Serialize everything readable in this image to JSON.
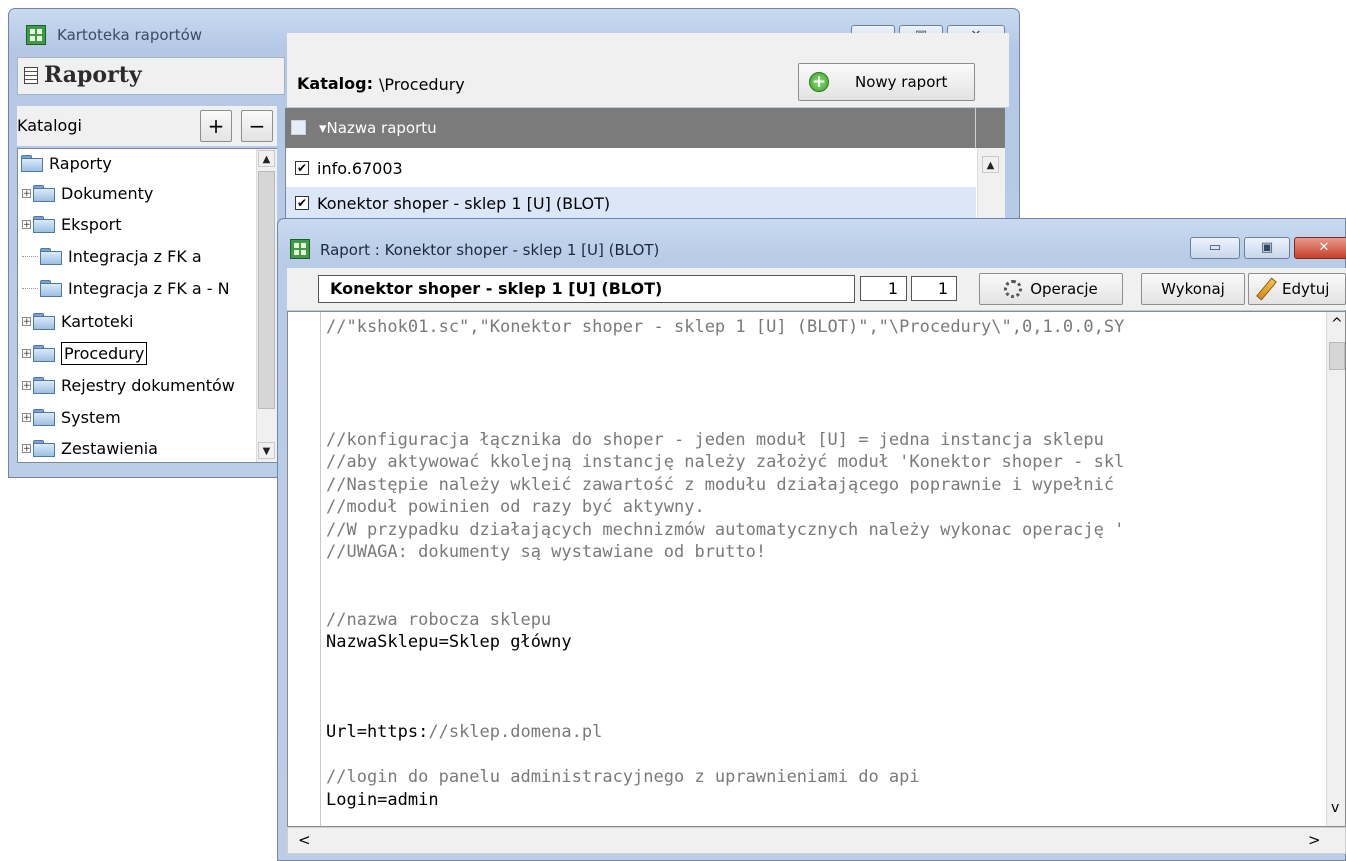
{
  "window_main": {
    "title": "Kartoteka raportów",
    "controls": {
      "minimize": "▭",
      "maximize": "▣",
      "close": "✕"
    }
  },
  "left_panel": {
    "header": "Raporty",
    "katalogi_label": "Katalogi",
    "add_label": "+",
    "remove_label": "−",
    "tree": [
      {
        "label": "Raporty",
        "expander": "",
        "selected": false
      },
      {
        "label": "Dokumenty",
        "expander": "+",
        "selected": false
      },
      {
        "label": "Eksport",
        "expander": "+",
        "selected": false
      },
      {
        "label": "Integracja z FK a",
        "expander": "",
        "selected": false
      },
      {
        "label": "Integracja z FK a - N",
        "expander": "",
        "selected": false
      },
      {
        "label": "Kartoteki",
        "expander": "+",
        "selected": false
      },
      {
        "label": "Procedury",
        "expander": "+",
        "selected": true
      },
      {
        "label": "Rejestry dokumentów",
        "expander": "+",
        "selected": false
      },
      {
        "label": "System",
        "expander": "+",
        "selected": false
      },
      {
        "label": "Zestawienia",
        "expander": "+",
        "selected": false
      }
    ]
  },
  "right_panel": {
    "katalog_label": "Katalog:",
    "katalog_path": "\\Procedury",
    "new_report_label": "Nowy raport",
    "column_header": "▾Nazwa raportu",
    "reports": [
      {
        "name": "info.67003",
        "checked": true
      },
      {
        "name": "Konektor shoper - sklep 1 [U] (BLOT)",
        "checked": true
      }
    ]
  },
  "window_report": {
    "title": "Raport : Konektor shoper - sklep 1 [U] (BLOT)",
    "name_field": "Konektor shoper - sklep 1 [U] (BLOT)",
    "page_a": "1",
    "page_b": "1",
    "operacje_label": "Operacje",
    "wykonaj_label": "Wykonaj",
    "edytuj_label": "Edytuj",
    "code_lines": [
      {
        "text": "//\"kshok01.sc\",\"Konektor shoper - sklep 1 [U] (BLOT)\",\"\\Procedury\\\",0,1.0.0,SY",
        "kind": "cmt"
      },
      {
        "text": "",
        "kind": "plain"
      },
      {
        "text": "",
        "kind": "plain"
      },
      {
        "text": "",
        "kind": "plain"
      },
      {
        "text": "",
        "kind": "plain"
      },
      {
        "text": "//konfiguracja łącznika do shoper - jeden moduł [U] = jedna instancja sklepu",
        "kind": "cmt"
      },
      {
        "text": "//aby aktywować kkolejną instancję należy założyć moduł 'Konektor shoper - skl",
        "kind": "cmt"
      },
      {
        "text": "//Następie należy wkleić zawartość z modułu działającego poprawnie i wypełnić",
        "kind": "cmt"
      },
      {
        "text": "//moduł powinien od razy być aktywny.",
        "kind": "cmt"
      },
      {
        "text": "//W przypadku działających mechnizmów automatycznych należy wykonac operację '",
        "kind": "cmt"
      },
      {
        "text": "//UWAGA: dokumenty są wystawiane od brutto!",
        "kind": "cmt"
      },
      {
        "text": "",
        "kind": "plain"
      },
      {
        "text": "",
        "kind": "plain"
      },
      {
        "text": "//nazwa robocza sklepu",
        "kind": "cmt"
      },
      {
        "text": "NazwaSklepu=Sklep główny",
        "kind": "plain"
      },
      {
        "text": "",
        "kind": "plain"
      },
      {
        "text": "",
        "kind": "plain"
      },
      {
        "text": "",
        "kind": "plain"
      },
      {
        "text": "Url=https://sklep.domena.pl",
        "kind": "url"
      },
      {
        "text": "",
        "kind": "plain"
      },
      {
        "text": "//login do panelu administracyjnego z uprawnieniami do api",
        "kind": "cmt"
      },
      {
        "text": "Login=admin",
        "kind": "plain"
      }
    ],
    "scroll": {
      "up": "^",
      "down": "v",
      "left": "<",
      "right": ">"
    }
  }
}
